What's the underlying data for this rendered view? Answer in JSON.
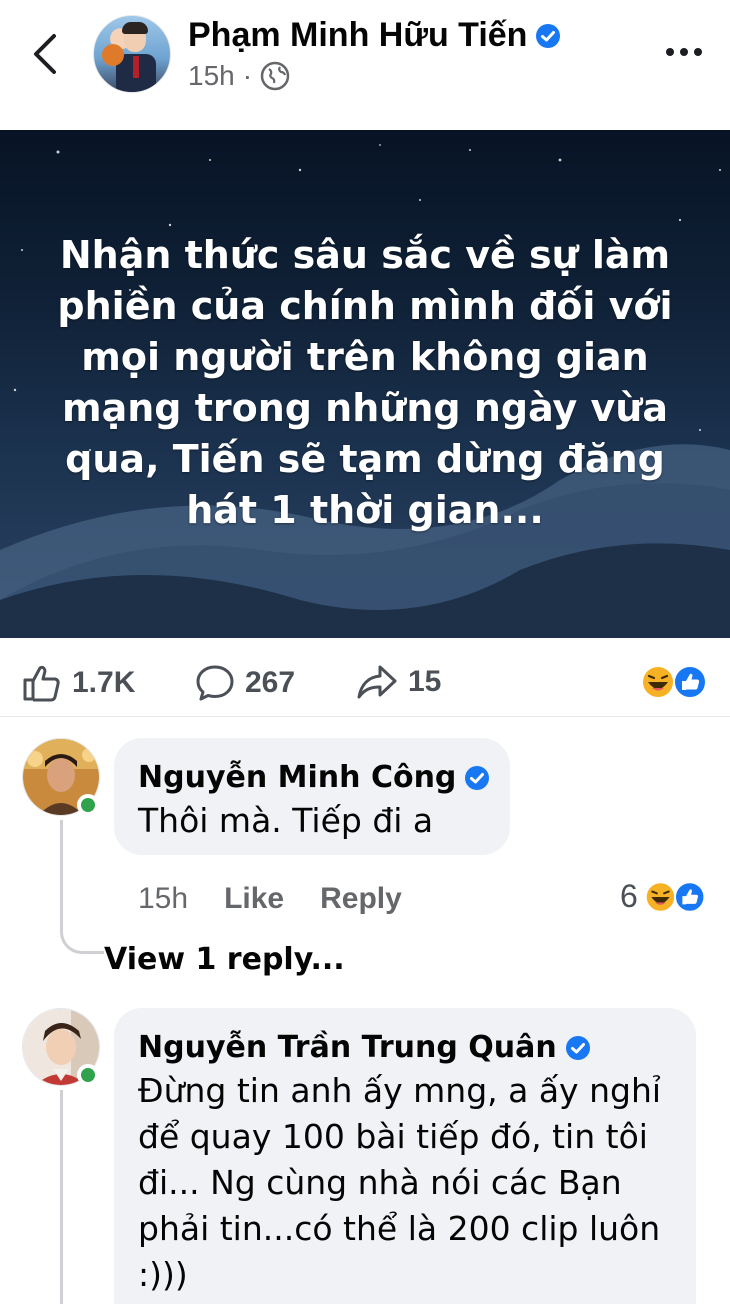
{
  "header": {
    "author": "Phạm Minh Hữu Tiến",
    "time": "15h",
    "separator": "·"
  },
  "post": {
    "text": "Nhận thức sâu sắc về sự làm phiền của chính mình đối với mọi người trên không gian mạng trong những ngày vừa qua, Tiến sẽ tạm dừng đăng hát 1 thời gian..."
  },
  "stats": {
    "likes": "1.7K",
    "comments": "267",
    "shares": "15"
  },
  "comments": [
    {
      "name": "Nguyễn Minh Công",
      "text": "Thôi mà. Tiếp đi a",
      "time": "15h",
      "like_label": "Like",
      "reply_label": "Reply",
      "reaction_count": "6",
      "view_replies": "View 1 reply..."
    },
    {
      "name": "Nguyễn Trần Trung Quân",
      "text": "Đừng tin anh ấy mng, a ấy nghỉ để quay 100 bài tiếp đó, tin tôi đi... Ng cùng nhà nói các Bạn phải tin...có thể là 200 clip luôn :)))"
    }
  ],
  "colors": {
    "verified": "#1877f2",
    "online": "#31a24c",
    "like_blue": "#1877f2",
    "haha_yellow": "#f7b125"
  }
}
